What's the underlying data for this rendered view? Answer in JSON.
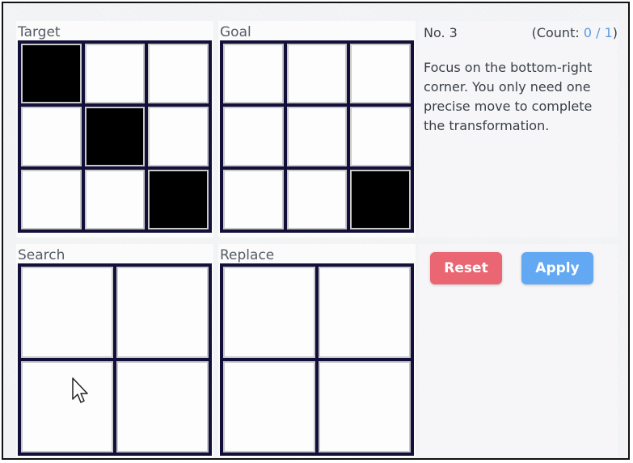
{
  "labels": {
    "target": "Target",
    "goal": "Goal",
    "search": "Search",
    "replace": "Replace"
  },
  "target_grid": [
    [
      1,
      0,
      0
    ],
    [
      0,
      1,
      0
    ],
    [
      0,
      0,
      1
    ]
  ],
  "goal_grid": [
    [
      0,
      0,
      0
    ],
    [
      0,
      0,
      0
    ],
    [
      0,
      0,
      1
    ]
  ],
  "search_grid": [
    [
      0,
      0
    ],
    [
      0,
      0
    ]
  ],
  "replace_grid": [
    [
      0,
      0
    ],
    [
      0,
      0
    ]
  ],
  "info": {
    "level": "No. 3",
    "count_prefix": "(Count: ",
    "count_current": "0",
    "count_sep": " / ",
    "count_total": "1",
    "count_suffix": ")",
    "description": "Focus on the bottom-right corner. You only need one precise move to complete the transformation."
  },
  "buttons": {
    "reset": "Reset",
    "apply": "Apply"
  },
  "colors": {
    "board_border": "#120f3a",
    "filled": "#000000",
    "empty": "#fdfdfd",
    "reset": "#ea6672",
    "apply": "#62a8f2",
    "count_accent": "#5a9be0"
  }
}
